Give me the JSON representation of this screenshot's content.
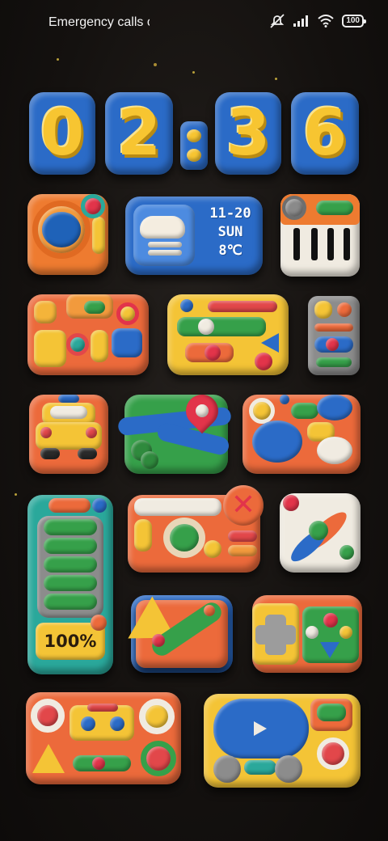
{
  "status_bar": {
    "carrier_text": "Emergency calls o",
    "icons": [
      "dnd-off-icon",
      "signal-icon",
      "wifi-icon",
      "battery-icon"
    ],
    "battery_level": "100"
  },
  "clock": {
    "h1": "0",
    "h2": "2",
    "m1": "3",
    "m2": "6",
    "separator": ":"
  },
  "weather": {
    "date": "11-20",
    "day": "SUN",
    "temp": "8℃",
    "icon": "cloud-icon"
  },
  "battery_widget": {
    "label": "100%",
    "level": 1.0
  },
  "apps": [
    "camera-app",
    "weather-widget",
    "piano-app",
    "toolbox-app",
    "slider-app",
    "remote-app",
    "taxi-app",
    "maps-app",
    "bird-app",
    "battery-widget",
    "browser-app",
    "compass-app",
    "wrench-app",
    "gamepad-app",
    "tape-app",
    "video-player-app"
  ],
  "colors": {
    "background": "#14110f",
    "clay_blue": "#2b6bc7",
    "clay_yellow": "#f7c531",
    "clay_orange": "#ee7b30",
    "clay_green": "#36a04a",
    "clay_red": "#e2474a"
  }
}
